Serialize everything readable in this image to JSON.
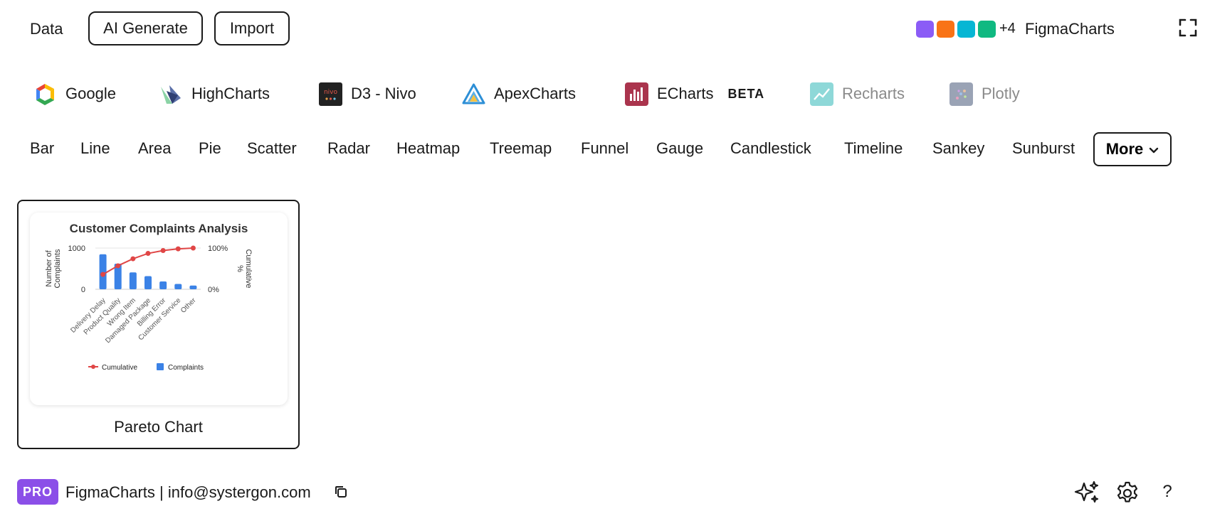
{
  "topbar": {
    "data_label": "Data",
    "ai_generate_label": "AI Generate",
    "import_label": "Import",
    "swatches": [
      "#8b5cf6",
      "#f97316",
      "#06b6d4",
      "#10b981"
    ],
    "more_swatches": "+4",
    "brand": "FigmaCharts",
    "expand_icon": "expand-icon"
  },
  "libraries": [
    {
      "label": "Google",
      "icon": "google-logo-icon",
      "dim": false
    },
    {
      "label": "HighCharts",
      "icon": "highcharts-logo-icon",
      "dim": false
    },
    {
      "label": "D3 - Nivo",
      "icon": "nivo-logo-icon",
      "dim": false
    },
    {
      "label": "ApexCharts",
      "icon": "apexcharts-logo-icon",
      "dim": false
    },
    {
      "label": "ECharts",
      "icon": "echarts-logo-icon",
      "dim": false,
      "badge": "BETA"
    },
    {
      "label": "Recharts",
      "icon": "recharts-logo-icon",
      "dim": true
    },
    {
      "label": "Plotly",
      "icon": "plotly-logo-icon",
      "dim": true
    }
  ],
  "chart_types": [
    "Bar",
    "Line",
    "Area",
    "Pie",
    "Scatter",
    "Radar",
    "Heatmap",
    "Treemap",
    "Funnel",
    "Gauge",
    "Candlestick",
    "Timeline",
    "Sankey",
    "Sunburst"
  ],
  "more_label": "More",
  "card": {
    "label": "Pareto Chart"
  },
  "chart_data": {
    "type": "bar",
    "title": "Customer Complaints Analysis",
    "ylabel": "Number of Complaints",
    "y2label": "Cumulative %",
    "ylim": [
      0,
      1000
    ],
    "y2lim": [
      0,
      100
    ],
    "yticks": [
      "1000",
      "0"
    ],
    "y2ticks": [
      "100%",
      "0%"
    ],
    "categories": [
      "Delivery Delay",
      "Product Quality",
      "Wrong Item",
      "Damaged Package",
      "Billing Error",
      "Customer Service",
      "Other"
    ],
    "series": [
      {
        "name": "Complaints",
        "type": "bar",
        "color": "#3b82e6",
        "values": [
          850,
          620,
          410,
          320,
          190,
          130,
          90
        ]
      },
      {
        "name": "Cumulative",
        "type": "line",
        "color": "#e04646",
        "values": [
          36,
          57,
          74,
          87,
          94,
          98,
          100
        ]
      }
    ],
    "legend": "bottom"
  },
  "footer": {
    "badge": "PRO",
    "text": "FigmaCharts | info@systergon.com",
    "copy_icon": "copy-icon",
    "sparkle_icon": "sparkle-icon",
    "gear_icon": "gear-icon",
    "help_label": "?"
  }
}
